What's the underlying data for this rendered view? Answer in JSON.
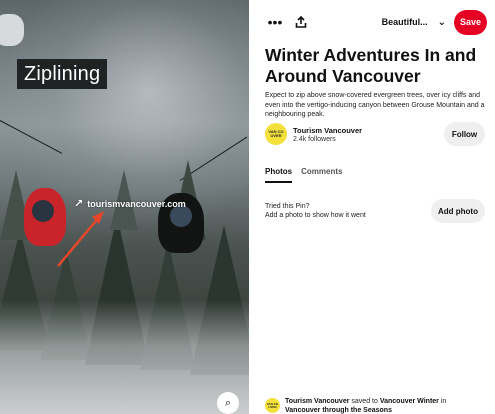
{
  "image": {
    "overlay_title": "Ziplining",
    "overlay_link": "tourismvancouver.com",
    "link_icon": "arrow-up-right-icon",
    "lens_icon": "visual-search-icon"
  },
  "toolbar": {
    "more_icon": "more-horizontal-icon",
    "share_icon": "share-icon",
    "board_name": "Beautiful...",
    "board_chevron_icon": "chevron-down-icon",
    "save_label": "Save",
    "accent": "#e60023"
  },
  "pin": {
    "title": "Winter Adventures In and Around Vancouver",
    "description": "Expect to zip above snow-covered evergreen trees, over icy cliffs and even into the vertigo-inducing canyon between Grouse Mountain and a neighbouring peak."
  },
  "creator": {
    "name": "Tourism Vancouver",
    "followers": "2.4k followers",
    "avatar_text": "VAN CO UVER",
    "follow_label": "Follow"
  },
  "tabs": [
    {
      "label": "Photos",
      "active": true
    },
    {
      "label": "Comments",
      "active": false
    }
  ],
  "tried": {
    "question": "Tried this Pin?",
    "prompt": "Add a photo to show how it went",
    "button_label": "Add photo"
  },
  "saved": {
    "user": "Tourism Vancouver",
    "saved_to": "saved to",
    "board": "Vancouver Winter",
    "in_text": "in",
    "parent_board": "Vancouver through the Seasons"
  }
}
